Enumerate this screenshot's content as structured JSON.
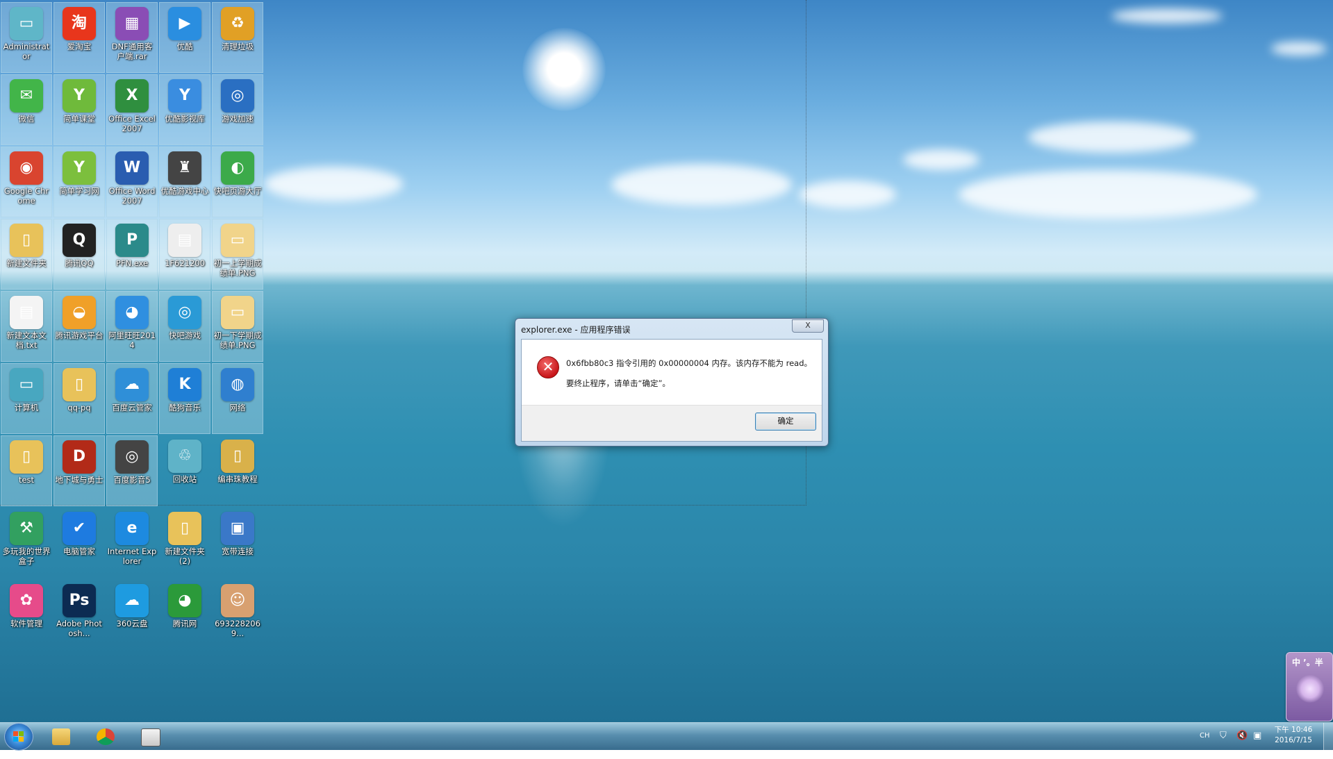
{
  "desktop": {
    "icons": [
      {
        "label": "Administrator",
        "glyph": "▭",
        "color": "#5fb6c8",
        "sel": true
      },
      {
        "label": "爱淘宝",
        "glyph": "淘",
        "color": "#e8361c",
        "sel": true
      },
      {
        "label": "DNF通用客户端.rar",
        "glyph": "▦",
        "color": "#8a4db5",
        "sel": true
      },
      {
        "label": "优酷",
        "glyph": "▶",
        "color": "#2a8ee0",
        "sel": true
      },
      {
        "label": "清理垃圾",
        "glyph": "♻",
        "color": "#e1a025",
        "sel": true
      },
      {
        "label": "微信",
        "glyph": "✉",
        "color": "#42b549",
        "sel": true
      },
      {
        "label": "简单课堂",
        "glyph": "Y",
        "color": "#6fba3b",
        "sel": true
      },
      {
        "label": "Office Excel 2007",
        "glyph": "X",
        "color": "#2f8f3f",
        "sel": true
      },
      {
        "label": "优酷影视库",
        "glyph": "Y",
        "color": "#3a8de0",
        "sel": true
      },
      {
        "label": "游戏加速",
        "glyph": "◎",
        "color": "#2a6fc2",
        "sel": true
      },
      {
        "label": "Google Chrome",
        "glyph": "◉",
        "color": "#d9442f",
        "sel": true
      },
      {
        "label": "简单学习网",
        "glyph": "Y",
        "color": "#7cbf3d",
        "sel": true
      },
      {
        "label": "Office Word 2007",
        "glyph": "W",
        "color": "#2a5db0",
        "sel": true
      },
      {
        "label": "优酷游戏中心",
        "glyph": "♜",
        "color": "#444444",
        "sel": true
      },
      {
        "label": "快吧页游大厅",
        "glyph": "◐",
        "color": "#3caa4a",
        "sel": true
      },
      {
        "label": "新建文件夹",
        "glyph": "▯",
        "color": "#e8c25a",
        "sel": true
      },
      {
        "label": "腾讯QQ",
        "glyph": "Q",
        "color": "#222222",
        "sel": true
      },
      {
        "label": "PFN.exe",
        "glyph": "P",
        "color": "#2b8a8a",
        "sel": true
      },
      {
        "label": "1F621200",
        "glyph": "▤",
        "color": "#eeeeee",
        "sel": true
      },
      {
        "label": "初一上学期成绩单.PNG",
        "glyph": "▭",
        "color": "#f1d48a",
        "sel": true
      },
      {
        "label": "新建文本文档.txt",
        "glyph": "▤",
        "color": "#f4f4f4",
        "sel": true
      },
      {
        "label": "腾讯游戏平台",
        "glyph": "◒",
        "color": "#f0a028",
        "sel": true
      },
      {
        "label": "阿里旺旺2014",
        "glyph": "◕",
        "color": "#2f8fe0",
        "sel": true
      },
      {
        "label": "快吧游戏",
        "glyph": "◎",
        "color": "#2a9ad6",
        "sel": true
      },
      {
        "label": "初一下学期成绩单.PNG",
        "glyph": "▭",
        "color": "#f1d48a",
        "sel": true
      },
      {
        "label": "计算机",
        "glyph": "▭",
        "color": "#48a7c0",
        "sel": true
      },
      {
        "label": "qq-pq",
        "glyph": "▯",
        "color": "#e8c25a",
        "sel": true
      },
      {
        "label": "百度云管家",
        "glyph": "☁",
        "color": "#2f8fd8",
        "sel": true
      },
      {
        "label": "酷狗音乐",
        "glyph": "K",
        "color": "#1f7fd6",
        "sel": true
      },
      {
        "label": "网络",
        "glyph": "◍",
        "color": "#2f7fcf",
        "sel": true
      },
      {
        "label": "test",
        "glyph": "▯",
        "color": "#e8c25a",
        "sel": true
      },
      {
        "label": "地下城与勇士",
        "glyph": "D",
        "color": "#b22a18",
        "sel": true
      },
      {
        "label": "百度影音5",
        "glyph": "◎",
        "color": "#444444",
        "sel": true
      },
      {
        "label": "回收站",
        "glyph": "♲",
        "color": "#5fb3c8",
        "sel": false
      },
      {
        "label": "编串珠教程",
        "glyph": "▯",
        "color": "#d9b14a",
        "sel": false
      },
      {
        "label": "多玩我的世界盒子",
        "glyph": "⚒",
        "color": "#32a060",
        "sel": false
      },
      {
        "label": "电脑管家",
        "glyph": "✔",
        "color": "#1e7be0",
        "sel": false
      },
      {
        "label": "Internet Explorer",
        "glyph": "e",
        "color": "#1d8ae0",
        "sel": false
      },
      {
        "label": "新建文件夹 (2)",
        "glyph": "▯",
        "color": "#e8c25a",
        "sel": false
      },
      {
        "label": "宽带连接",
        "glyph": "▣",
        "color": "#3a78c8",
        "sel": false
      },
      {
        "label": "软件管理",
        "glyph": "✿",
        "color": "#e64b8a",
        "sel": false
      },
      {
        "label": "Adobe Photosh...",
        "glyph": "Ps",
        "color": "#0c2b52",
        "sel": false
      },
      {
        "label": "360云盘",
        "glyph": "☁",
        "color": "#1e9be0",
        "sel": false
      },
      {
        "label": "腾讯网",
        "glyph": "◕",
        "color": "#2b9a3a",
        "sel": false
      },
      {
        "label": "6932282069...",
        "glyph": "☺",
        "color": "#d8a070",
        "sel": false
      }
    ]
  },
  "dialog": {
    "title": "explorer.exe - 应用程序错误",
    "close": "X",
    "error_icon": "✕",
    "message_line1": "0x6fbb80c3 指令引用的 0x00000004 内存。该内存不能为 read。",
    "message_line2": "要终止程序，请单击“确定”。",
    "ok_label": "确定"
  },
  "taskbar": {
    "lang": "CH",
    "time": "下午 10:46",
    "date": "2016/7/15"
  },
  "ime": {
    "label": "中 ’。半"
  }
}
